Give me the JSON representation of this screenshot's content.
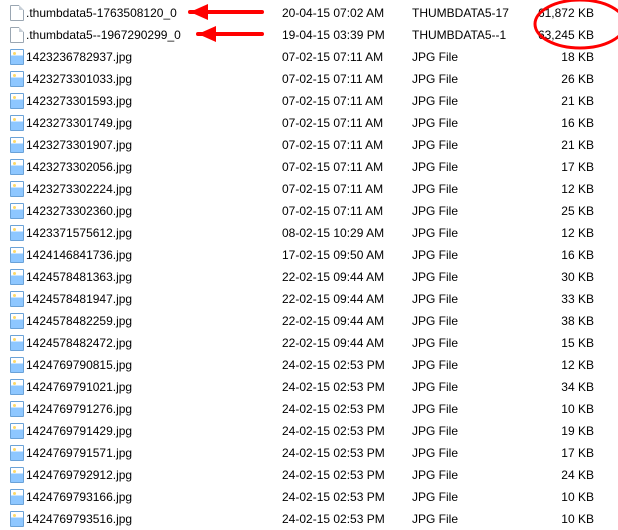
{
  "files": [
    {
      "icon": "file",
      "name": ".thumbdata5-1763508120_0",
      "date": "20-04-15 07:02 AM",
      "type": "THUMBDATA5-17",
      "size": "61,872 KB"
    },
    {
      "icon": "file",
      "name": ".thumbdata5--1967290299_0",
      "date": "19-04-15 03:39 PM",
      "type": "THUMBDATA5--1",
      "size": "63,245 KB"
    },
    {
      "icon": "image",
      "name": "1423236782937.jpg",
      "date": "07-02-15 07:11 AM",
      "type": "JPG File",
      "size": "18 KB"
    },
    {
      "icon": "image",
      "name": "1423273301033.jpg",
      "date": "07-02-15 07:11 AM",
      "type": "JPG File",
      "size": "26 KB"
    },
    {
      "icon": "image",
      "name": "1423273301593.jpg",
      "date": "07-02-15 07:11 AM",
      "type": "JPG File",
      "size": "21 KB"
    },
    {
      "icon": "image",
      "name": "1423273301749.jpg",
      "date": "07-02-15 07:11 AM",
      "type": "JPG File",
      "size": "16 KB"
    },
    {
      "icon": "image",
      "name": "1423273301907.jpg",
      "date": "07-02-15 07:11 AM",
      "type": "JPG File",
      "size": "21 KB"
    },
    {
      "icon": "image",
      "name": "1423273302056.jpg",
      "date": "07-02-15 07:11 AM",
      "type": "JPG File",
      "size": "17 KB"
    },
    {
      "icon": "image",
      "name": "1423273302224.jpg",
      "date": "07-02-15 07:11 AM",
      "type": "JPG File",
      "size": "12 KB"
    },
    {
      "icon": "image",
      "name": "1423273302360.jpg",
      "date": "07-02-15 07:11 AM",
      "type": "JPG File",
      "size": "25 KB"
    },
    {
      "icon": "image",
      "name": "1423371575612.jpg",
      "date": "08-02-15 10:29 AM",
      "type": "JPG File",
      "size": "12 KB"
    },
    {
      "icon": "image",
      "name": "1424146841736.jpg",
      "date": "17-02-15 09:50 AM",
      "type": "JPG File",
      "size": "16 KB"
    },
    {
      "icon": "image",
      "name": "1424578481363.jpg",
      "date": "22-02-15 09:44 AM",
      "type": "JPG File",
      "size": "30 KB"
    },
    {
      "icon": "image",
      "name": "1424578481947.jpg",
      "date": "22-02-15 09:44 AM",
      "type": "JPG File",
      "size": "33 KB"
    },
    {
      "icon": "image",
      "name": "1424578482259.jpg",
      "date": "22-02-15 09:44 AM",
      "type": "JPG File",
      "size": "38 KB"
    },
    {
      "icon": "image",
      "name": "1424578482472.jpg",
      "date": "22-02-15 09:44 AM",
      "type": "JPG File",
      "size": "15 KB"
    },
    {
      "icon": "image",
      "name": "1424769790815.jpg",
      "date": "24-02-15 02:53 PM",
      "type": "JPG File",
      "size": "12 KB"
    },
    {
      "icon": "image",
      "name": "1424769791021.jpg",
      "date": "24-02-15 02:53 PM",
      "type": "JPG File",
      "size": "34 KB"
    },
    {
      "icon": "image",
      "name": "1424769791276.jpg",
      "date": "24-02-15 02:53 PM",
      "type": "JPG File",
      "size": "10 KB"
    },
    {
      "icon": "image",
      "name": "1424769791429.jpg",
      "date": "24-02-15 02:53 PM",
      "type": "JPG File",
      "size": "19 KB"
    },
    {
      "icon": "image",
      "name": "1424769791571.jpg",
      "date": "24-02-15 02:53 PM",
      "type": "JPG File",
      "size": "17 KB"
    },
    {
      "icon": "image",
      "name": "1424769792912.jpg",
      "date": "24-02-15 02:53 PM",
      "type": "JPG File",
      "size": "24 KB"
    },
    {
      "icon": "image",
      "name": "1424769793166.jpg",
      "date": "24-02-15 02:53 PM",
      "type": "JPG File",
      "size": "10 KB"
    },
    {
      "icon": "image",
      "name": "1424769793516.jpg",
      "date": "24-02-15 02:53 PM",
      "type": "JPG File",
      "size": "10 KB"
    }
  ],
  "annotations": {
    "color": "#ff0000"
  }
}
